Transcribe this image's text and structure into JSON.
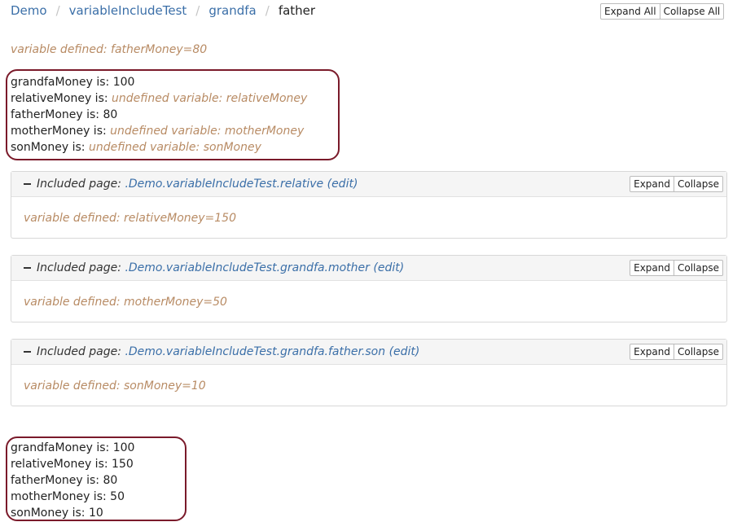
{
  "breadcrumb": {
    "items": [
      "Demo",
      "variableIncludeTest",
      "grandfa"
    ],
    "current": "father",
    "separator": "/"
  },
  "toolbar": {
    "expand_all": "Expand All",
    "collapse_all": "Collapse All"
  },
  "top_variable": "variable defined: fatherMoney=80",
  "first_block": [
    {
      "label": "grandfaMoney is: ",
      "value": "100",
      "undefined": false
    },
    {
      "label": "relativeMoney is: ",
      "value": "undefined variable: relativeMoney",
      "undefined": true
    },
    {
      "label": "fatherMoney is: ",
      "value": "80",
      "undefined": false
    },
    {
      "label": "motherMoney is: ",
      "value": "undefined variable: motherMoney",
      "undefined": true
    },
    {
      "label": "sonMoney is: ",
      "value": "undefined variable: sonMoney",
      "undefined": true
    }
  ],
  "included_label": "Included page: ",
  "includes": [
    {
      "link": ".Demo.variableIncludeTest.relative (edit)",
      "body": "variable defined: relativeMoney=150",
      "expand": "Expand",
      "collapse": "Collapse"
    },
    {
      "link": ".Demo.variableIncludeTest.grandfa.mother (edit)",
      "body": "variable defined: motherMoney=50",
      "expand": "Expand",
      "collapse": "Collapse"
    },
    {
      "link": ".Demo.variableIncludeTest.grandfa.father.son (edit)",
      "body": "variable defined: sonMoney=10",
      "expand": "Expand",
      "collapse": "Collapse"
    }
  ],
  "second_block": [
    {
      "label": "grandfaMoney is: ",
      "value": "100"
    },
    {
      "label": "relativeMoney is: ",
      "value": "150"
    },
    {
      "label": "fatherMoney is: ",
      "value": "80"
    },
    {
      "label": "motherMoney is: ",
      "value": "50"
    },
    {
      "label": "sonMoney is: ",
      "value": "10"
    }
  ],
  "colors": {
    "link": "#3b6fa8",
    "variable": "#b88b64",
    "annotation": "#7a1a2a"
  }
}
